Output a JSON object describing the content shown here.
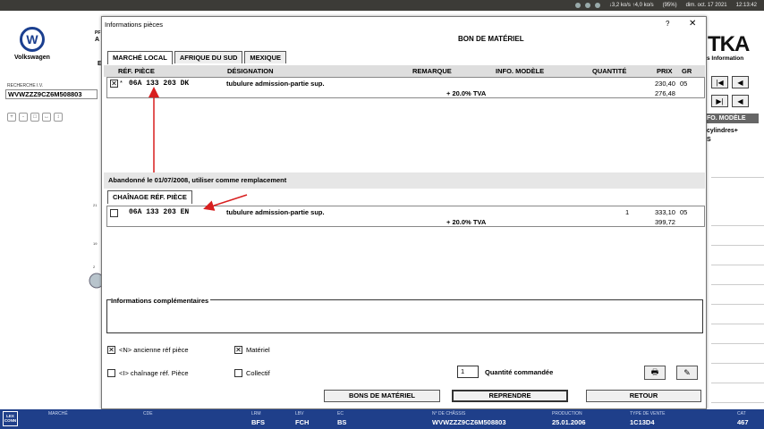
{
  "os_bar": {
    "net_speed": "↓3,2 ko/s ↑4,0 ko/s",
    "battery": "(95%)",
    "datetime": "dim. oct. 17 2021",
    "time": "12:13:42"
  },
  "background": {
    "brand_name": "Volkswagen",
    "search_label": "RECHERCHE I.V.",
    "search_value": "WVWZZZ9CZ6M508803",
    "left_frag_top": "PF",
    "left_frag_2": "A",
    "left_frag_3": "E",
    "tka_logo": "TKA",
    "tka_sub": "s Information",
    "info_modele": "FO. MODÈLE",
    "right_text_1": "cylindres+",
    "right_text_2": "S",
    "side_num_1": "21",
    "side_num_2": "19",
    "side_num_3": "2",
    "zoom_icons": [
      "+",
      "-",
      "□",
      "↔",
      "↕"
    ]
  },
  "dialog": {
    "title": "Informations pièces",
    "help": "?",
    "close": "✕",
    "bon_title": "BON DE MATÉRIEL",
    "tabs": [
      {
        "label": "MARCHÉ LOCAL",
        "active": true
      },
      {
        "label": "AFRIQUE DU SUD",
        "active": false
      },
      {
        "label": "MEXIQUE",
        "active": false
      }
    ],
    "columns": {
      "ref": "RÉF. PIÈCE",
      "designation": "DÉSIGNATION",
      "remarque": "REMARQUE",
      "info_modele": "INFO. MODÈLE",
      "quantite": "QUANTITÉ",
      "prix": "PRIX",
      "gr": "GR"
    },
    "local_row": {
      "checked": "✕",
      "marker": "*",
      "ref": "06A 133 203 DK",
      "designation": "tubulure admission-partie sup.",
      "quantity": "",
      "price": "230,40",
      "gr": "05",
      "tva_label": "+ 20.0% TVA",
      "price_ttc": "276,48"
    },
    "replacement_note": "Abandonné le 01/07/2008, utiliser comme remplacement",
    "chain_tab": "CHAÎNAGE RÉF. PIÈCE",
    "chain_row": {
      "checked": "",
      "ref": "06A 133 203 EN",
      "designation": "tubulure admission-partie sup.",
      "quantity": "1",
      "price": "333,10",
      "gr": "05",
      "tva_label": "+ 20.0% TVA",
      "price_ttc": "399,72"
    },
    "info_label": "Informations complémentaires",
    "options": {
      "ancienne": {
        "label": "<N> ancienne réf pièce",
        "checked": "✕"
      },
      "materiel": {
        "label": "Matériel",
        "checked": "✕"
      },
      "chainage": {
        "label": "<I> chaînage réf. Pièce",
        "checked": ""
      },
      "collectif": {
        "label": "Collectif",
        "checked": ""
      }
    },
    "qty_value": "1",
    "qty_label": "Quantité commandée",
    "print_icon": "🖶",
    "edit_icon": "✎",
    "buttons": {
      "bons": "BONS DE MATÉRIEL",
      "reprendre": "REPRENDRE",
      "retour": "RETOUR"
    }
  },
  "status_bar": {
    "lex": "LEX CONN",
    "fields": [
      {
        "label": "MARCHÉ",
        "value": ""
      },
      {
        "label": "CDE",
        "value": ""
      },
      {
        "label": "LRM",
        "value": "BFS"
      },
      {
        "label": "LBV",
        "value": "FCH"
      },
      {
        "label": "EC",
        "value": "BS"
      },
      {
        "label": "N° DE CHÂSSIS",
        "value": "WVWZZZ9CZ6M508803"
      },
      {
        "label": "PRODUCTION",
        "value": "25.01.2006"
      },
      {
        "label": "TYPE DE VENTE",
        "value": "1C13D4"
      },
      {
        "label": "CAT",
        "value": "467"
      }
    ]
  },
  "colors": {
    "status_bar": "#1f3f8a",
    "annotation_arrow": "#d81f1f",
    "os_bar": "#3c3b37"
  }
}
